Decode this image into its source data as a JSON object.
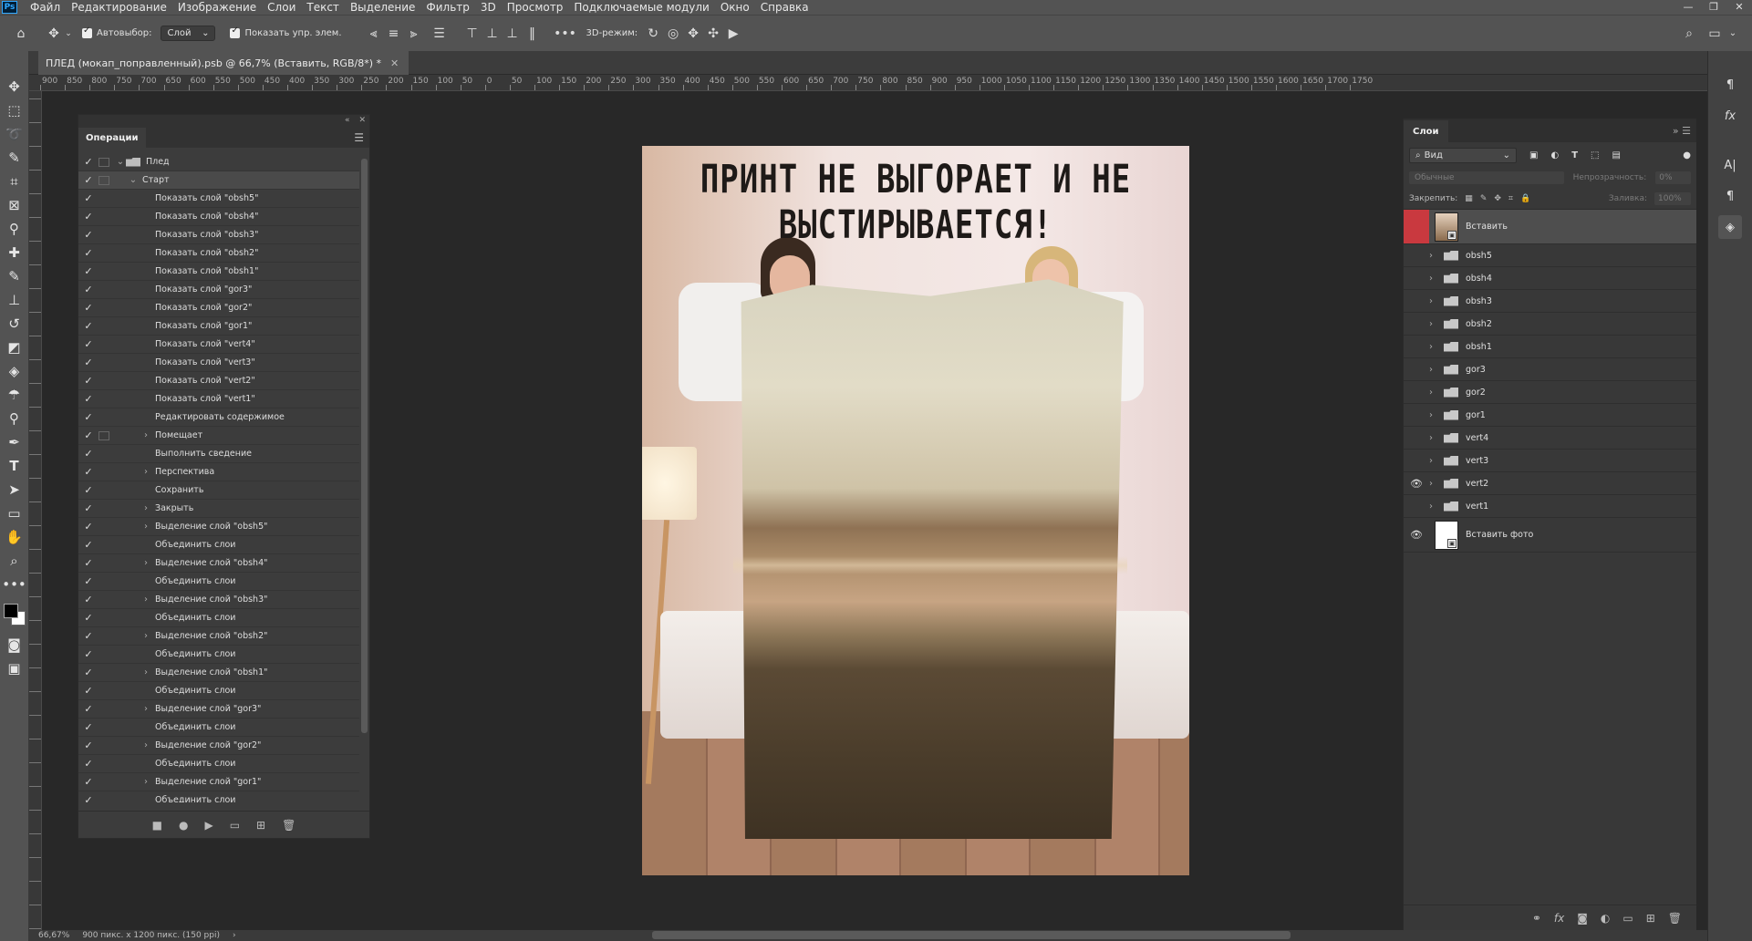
{
  "menu": {
    "logo": "Ps",
    "items": [
      "Файл",
      "Редактирование",
      "Изображение",
      "Слои",
      "Текст",
      "Выделение",
      "Фильтр",
      "3D",
      "Просмотр",
      "Подключаемые модули",
      "Окно",
      "Справка"
    ]
  },
  "options": {
    "autoselect_label": "Автовыбор:",
    "autoselect_value": "Слой",
    "show_transform_label": "Показать упр. элем.",
    "mode3d_label": "3D-режим:"
  },
  "document": {
    "tab_title": "ПЛЕД (мокап_поправленный).psb @ 66,7% (Вставить, RGB/8*) *",
    "headline": "ПРИНТ НЕ ВЫГОРАЕТ И НЕ ВЫСТИРЫВАЕТСЯ!"
  },
  "ruler_labels": [
    "900",
    "850",
    "800",
    "750",
    "700",
    "650",
    "600",
    "550",
    "500",
    "450",
    "400",
    "350",
    "300",
    "250",
    "200",
    "150",
    "100",
    "50",
    "0",
    "50",
    "100",
    "150",
    "200",
    "250",
    "300",
    "350",
    "400",
    "450",
    "500",
    "550",
    "600",
    "650",
    "700",
    "750",
    "800",
    "850",
    "900",
    "950",
    "1000",
    "1050",
    "1100",
    "1150",
    "1200",
    "1250",
    "1300",
    "1350",
    "1400",
    "1450",
    "1500",
    "1550",
    "1600",
    "1650",
    "1700",
    "1750"
  ],
  "actions_panel": {
    "title": "Операции",
    "rows": [
      {
        "label": "Плед",
        "level": 0,
        "check": true,
        "dialog": true,
        "expand": "⌄",
        "folder": true
      },
      {
        "label": "Старт",
        "level": 1,
        "check": true,
        "dialog": true,
        "expand": "⌄",
        "selected": true
      },
      {
        "label": "Показать слой \"obsh5\"",
        "level": 2,
        "check": true
      },
      {
        "label": "Показать слой \"obsh4\"",
        "level": 2,
        "check": true
      },
      {
        "label": "Показать слой \"obsh3\"",
        "level": 2,
        "check": true
      },
      {
        "label": "Показать слой \"obsh2\"",
        "level": 2,
        "check": true
      },
      {
        "label": "Показать слой \"obsh1\"",
        "level": 2,
        "check": true
      },
      {
        "label": "Показать слой \"gor3\"",
        "level": 2,
        "check": true
      },
      {
        "label": "Показать слой \"gor2\"",
        "level": 2,
        "check": true
      },
      {
        "label": "Показать слой \"gor1\"",
        "level": 2,
        "check": true
      },
      {
        "label": "Показать слой \"vert4\"",
        "level": 2,
        "check": true
      },
      {
        "label": "Показать слой \"vert3\"",
        "level": 2,
        "check": true
      },
      {
        "label": "Показать слой \"vert2\"",
        "level": 2,
        "check": true
      },
      {
        "label": "Показать слой \"vert1\"",
        "level": 2,
        "check": true
      },
      {
        "label": "Редактировать содержимое",
        "level": 2,
        "check": true
      },
      {
        "label": "Помещает",
        "level": 2,
        "check": true,
        "dialog": true,
        "expand": "›"
      },
      {
        "label": "Выполнить сведение",
        "level": 2,
        "check": true
      },
      {
        "label": "Перспектива",
        "level": 2,
        "check": true,
        "expand": "›"
      },
      {
        "label": "Сохранить",
        "level": 2,
        "check": true
      },
      {
        "label": "Закрыть",
        "level": 2,
        "check": true,
        "expand": "›"
      },
      {
        "label": "Выделение слой \"obsh5\"",
        "level": 2,
        "check": true,
        "expand": "›"
      },
      {
        "label": "Объединить слои",
        "level": 2,
        "check": true
      },
      {
        "label": "Выделение слой \"obsh4\"",
        "level": 2,
        "check": true,
        "expand": "›"
      },
      {
        "label": "Объединить слои",
        "level": 2,
        "check": true
      },
      {
        "label": "Выделение слой \"obsh3\"",
        "level": 2,
        "check": true,
        "expand": "›"
      },
      {
        "label": "Объединить слои",
        "level": 2,
        "check": true
      },
      {
        "label": "Выделение слой \"obsh2\"",
        "level": 2,
        "check": true,
        "expand": "›"
      },
      {
        "label": "Объединить слои",
        "level": 2,
        "check": true
      },
      {
        "label": "Выделение слой \"obsh1\"",
        "level": 2,
        "check": true,
        "expand": "›"
      },
      {
        "label": "Объединить слои",
        "level": 2,
        "check": true
      },
      {
        "label": "Выделение слой \"gor3\"",
        "level": 2,
        "check": true,
        "expand": "›"
      },
      {
        "label": "Объединить слои",
        "level": 2,
        "check": true
      },
      {
        "label": "Выделение слой \"gor2\"",
        "level": 2,
        "check": true,
        "expand": "›"
      },
      {
        "label": "Объединить слои",
        "level": 2,
        "check": true
      },
      {
        "label": "Выделение слой \"gor1\"",
        "level": 2,
        "check": true,
        "expand": "›"
      },
      {
        "label": "Объединить слои",
        "level": 2,
        "check": true
      }
    ]
  },
  "layers_panel": {
    "title": "Слои",
    "filter_value": "Вид",
    "blend_mode": "Обычные",
    "opacity_label": "Непрозрачность:",
    "opacity_value": "0%",
    "lock_label": "Закрепить:",
    "fill_label": "Заливка:",
    "fill_value": "100%",
    "layers": [
      {
        "name": "Вставить",
        "type": "smart",
        "visible": false,
        "active": true
      },
      {
        "name": "obsh5",
        "type": "group",
        "visible": false
      },
      {
        "name": "obsh4",
        "type": "group",
        "visible": false
      },
      {
        "name": "obsh3",
        "type": "group",
        "visible": false
      },
      {
        "name": "obsh2",
        "type": "group",
        "visible": false
      },
      {
        "name": "obsh1",
        "type": "group",
        "visible": false
      },
      {
        "name": "gor3",
        "type": "group",
        "visible": false
      },
      {
        "name": "gor2",
        "type": "group",
        "visible": false
      },
      {
        "name": "gor1",
        "type": "group",
        "visible": false
      },
      {
        "name": "vert4",
        "type": "group",
        "visible": false
      },
      {
        "name": "vert3",
        "type": "group",
        "visible": false
      },
      {
        "name": "vert2",
        "type": "group",
        "visible": true
      },
      {
        "name": "vert1",
        "type": "group",
        "visible": false
      },
      {
        "name": "Вставить фото",
        "type": "smart-white",
        "visible": true
      }
    ]
  },
  "status": {
    "zoom": "66,67%",
    "doc_size": "900 пикс. x 1200 пикс. (150 ppi)"
  },
  "colors": {
    "accent_red": "#c9393f",
    "panel_bg": "#3c3c3c",
    "ui_bg": "#535353"
  }
}
